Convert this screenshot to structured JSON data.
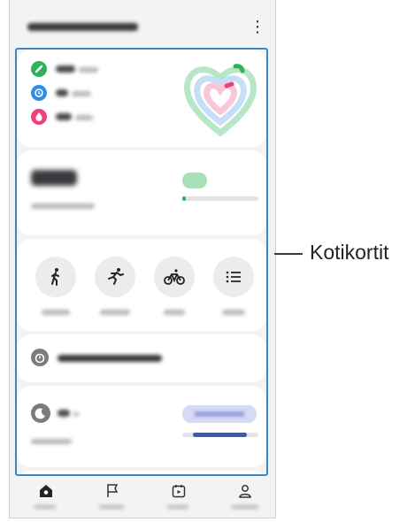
{
  "callout": {
    "label": "Kotikortit"
  },
  "colors": {
    "frame": "#3b85c6",
    "green": "#2fb35a",
    "blue": "#2f8de4",
    "pink": "#ef3f7e",
    "sleep": "#3f56b3"
  },
  "app": {
    "title_blurred": true,
    "menu_icon": "more-vertical-icon"
  },
  "summary_card": {
    "rows": [
      {
        "icon": "steps-icon"
      },
      {
        "icon": "clock-icon"
      },
      {
        "icon": "flame-icon"
      }
    ],
    "chart_icon": "heart-rings-icon"
  },
  "steps_card": {
    "progress": 0.05
  },
  "workout_card": {
    "buttons": [
      {
        "icon": "walking-icon"
      },
      {
        "icon": "running-icon"
      },
      {
        "icon": "cycling-icon"
      },
      {
        "icon": "list-icon"
      }
    ]
  },
  "history_card": {
    "icon": "stopwatch-icon"
  },
  "sleep_card": {
    "icon": "moon-icon",
    "progress": 0.85
  },
  "navbar": {
    "items": [
      {
        "icon": "home-icon",
        "active": true
      },
      {
        "icon": "flag-icon"
      },
      {
        "icon": "calendar-play-icon"
      },
      {
        "icon": "person-icon"
      }
    ]
  }
}
